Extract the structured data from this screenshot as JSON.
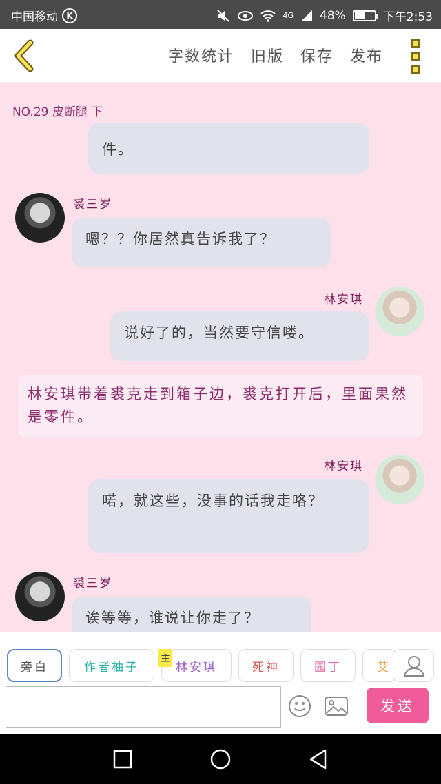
{
  "status": {
    "carrier": "中国移动",
    "carrier_badge": "K",
    "network": "4G",
    "battery": "48%",
    "battery_level": 0.48,
    "time": "下午2:53"
  },
  "toolbar": {
    "actions": [
      "字数统计",
      "旧版",
      "保存",
      "发布"
    ]
  },
  "chapter": {
    "title": "NO.29 皮断腿 下"
  },
  "messages": [
    {
      "text": "件。"
    },
    {
      "name": "裘三岁",
      "text": "嗯？？你居然真告诉我了？"
    },
    {
      "name": "林安琪",
      "text": "说好了的，当然要守信喽。"
    },
    {
      "narration": "林安琪带着裘克走到箱子边，裘克打开后，里面果然是零件。"
    },
    {
      "name": "林安琪",
      "text": "喏，就这些，没事的话我走咯？"
    },
    {
      "name": "裘三岁",
      "text": "诶等等，谁说让你走了？"
    }
  ],
  "characters": [
    {
      "label": "旁白",
      "color": "#555555"
    },
    {
      "label": "作者柚子",
      "color": "#2bb3a8"
    },
    {
      "label": "林安琪",
      "color": "#9b59c9",
      "badge": "主"
    },
    {
      "label": "死神",
      "color": "#d9534f"
    },
    {
      "label": "园丁",
      "color": "#e0609a"
    },
    {
      "label": "艾",
      "color": "#e8a04a"
    }
  ],
  "input": {
    "placeholder": "",
    "send_label": "发送"
  },
  "colors": {
    "background": "#fde0ea",
    "bubble": "#e2e2ed",
    "send": "#f05b9a",
    "narration_text": "#8a2a6a"
  },
  "icons": [
    "back-arrow-icon",
    "more-menu-icon",
    "person-icon",
    "emoji-icon",
    "image-icon",
    "square-icon",
    "circle-icon",
    "triangle-back-icon"
  ]
}
